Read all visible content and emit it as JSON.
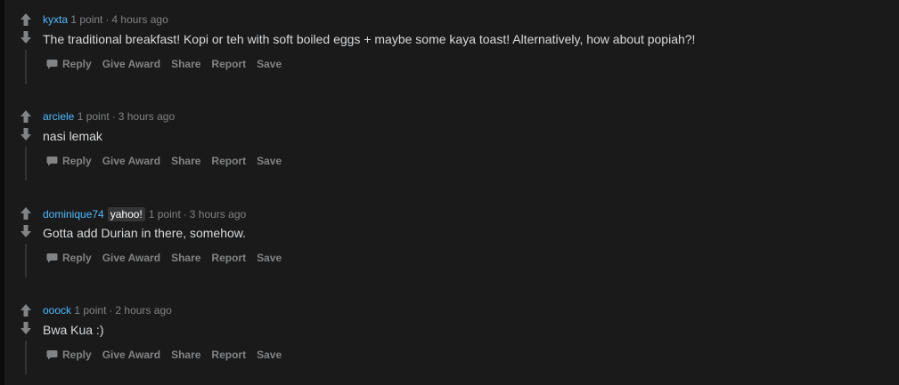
{
  "colors": {
    "background": "#1a1a1b",
    "author": "#4fbcff",
    "text": "#d7dadc",
    "muted": "#818384"
  },
  "actions": {
    "reply": "Reply",
    "give_award": "Give Award",
    "share": "Share",
    "report": "Report",
    "save": "Save"
  },
  "comments": [
    {
      "author": "kyxta",
      "flair": "",
      "points": "1 point",
      "separator": "·",
      "time": "4 hours ago",
      "body": "The traditional breakfast! Kopi or teh with soft boiled eggs + maybe some kaya toast! Alternatively, how about popiah?!"
    },
    {
      "author": "arciele",
      "flair": "",
      "points": "1 point",
      "separator": "·",
      "time": "3 hours ago",
      "body": "nasi lemak"
    },
    {
      "author": "dominique74",
      "flair": "yahoo!",
      "points": "1 point",
      "separator": "·",
      "time": "3 hours ago",
      "body": "Gotta add Durian in there, somehow."
    },
    {
      "author": "ooock",
      "flair": "",
      "points": "1 point",
      "separator": "·",
      "time": "2 hours ago",
      "body": "Bwa Kua :)"
    }
  ]
}
